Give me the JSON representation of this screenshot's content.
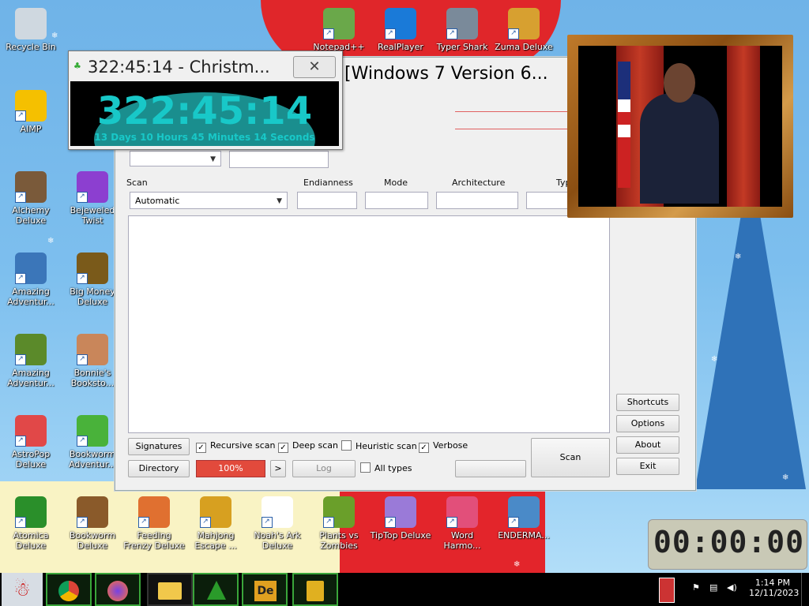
{
  "desktop": {
    "icons": [
      {
        "label": "Recycle Bin",
        "color": "#cfd8e0"
      },
      {
        "label": "AIMP",
        "color": "#f5c000"
      },
      {
        "label": "Alchemy Deluxe",
        "color": "#7a5a3a"
      },
      {
        "label": "Amazing Adventur...",
        "color": "#3b76b9"
      },
      {
        "label": "Amazing Adventur...",
        "color": "#5b8a2a"
      },
      {
        "label": "AstroPop Deluxe",
        "color": "#e14848"
      },
      {
        "label": "Atomica Deluxe",
        "color": "#2a8f2a"
      },
      {
        "label": "Bejeweled Twist",
        "color": "#8c3fd0"
      },
      {
        "label": "Big Money Deluxe",
        "color": "#7a5a1a"
      },
      {
        "label": "Bonnie's Booksto...",
        "color": "#c9865a"
      },
      {
        "label": "Bookworm Adventur...",
        "color": "#49b23a"
      },
      {
        "label": "Bookworm Deluxe",
        "color": "#8a5a2a"
      },
      {
        "label": "Feeding Frenzy Deluxe",
        "color": "#e07030"
      },
      {
        "label": "Mahjong Escape ...",
        "color": "#d7a020"
      },
      {
        "label": "Noah's Ark Deluxe",
        "color": "#ffffff"
      },
      {
        "label": "Plants vs Zombies",
        "color": "#6a9f2a"
      },
      {
        "label": "TipTop Deluxe",
        "color": "#9a7ad8"
      },
      {
        "label": "Word Harmo...",
        "color": "#e24f7a"
      },
      {
        "label": "ENDERMA...",
        "color": "#4a8ac8"
      },
      {
        "label": "RealPlayer",
        "color": "#1a7ad8"
      },
      {
        "label": "Typer Shark",
        "color": "#7a8a9a"
      },
      {
        "label": "Zuma Deluxe",
        "color": "#d7a030"
      },
      {
        "label": "Notepad++",
        "color": "#6aa84a"
      }
    ]
  },
  "timer": {
    "title": "322:45:14 - Christm...",
    "close": "✕",
    "big": "322:45:14",
    "detail": "13 Days 10 Hours 45 Minutes 14 Seconds"
  },
  "main": {
    "title": "[Windows 7 Version 6...",
    "scan_label": "Scan",
    "scan_value": "Automatic",
    "endianness_label": "Endianness",
    "mode_label": "Mode",
    "architecture_label": "Architecture",
    "type_label": "Typ",
    "side_buttons": [
      "Shortcuts",
      "Options",
      "About",
      "Exit"
    ],
    "signatures_button": "Signatures",
    "directory_button": "Directory",
    "progress_text": "100%",
    "progress_value": 100,
    "next_button": ">",
    "log_button": "Log",
    "scan_button": "Scan",
    "checks": [
      {
        "label": "Recursive scan",
        "checked": true
      },
      {
        "label": "Deep scan",
        "checked": true
      },
      {
        "label": "Heuristic scan",
        "checked": false
      },
      {
        "label": "Verbose",
        "checked": true
      }
    ],
    "all_types": {
      "label": "All types",
      "checked": false
    }
  },
  "clock_widget": {
    "digits": "00:00:00"
  },
  "taskbar": {
    "time": "1:14 PM",
    "date": "12/11/2023"
  }
}
